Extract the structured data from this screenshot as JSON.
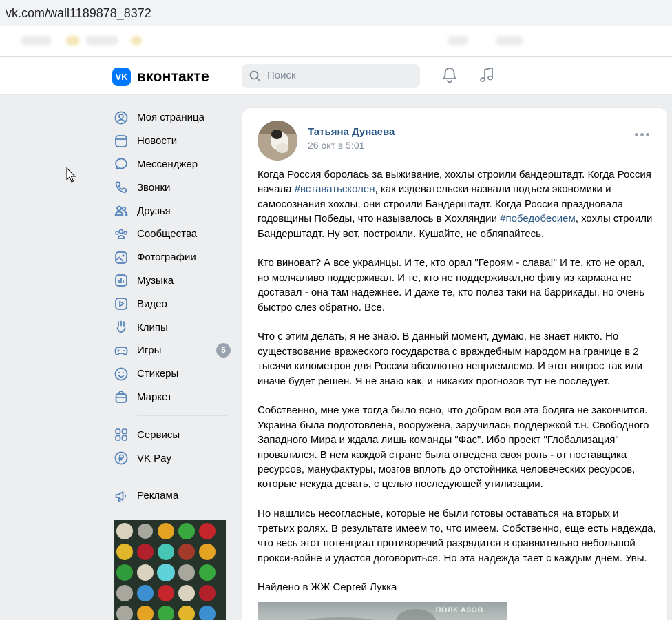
{
  "browser": {
    "url": "vk.com/wall1189878_8372"
  },
  "header": {
    "logo_mark": "VK",
    "logo_text": "вконтакте",
    "search_placeholder": "Поиск",
    "icons": [
      "bell-icon",
      "music-note-icon"
    ]
  },
  "sidebar": {
    "items": [
      {
        "label": "Моя страница",
        "icon": "user-circle-icon"
      },
      {
        "label": "Новости",
        "icon": "news-icon"
      },
      {
        "label": "Мессенджер",
        "icon": "chat-bubble-icon"
      },
      {
        "label": "Звонки",
        "icon": "phone-icon"
      },
      {
        "label": "Друзья",
        "icon": "friends-icon"
      },
      {
        "label": "Сообщества",
        "icon": "communities-icon"
      },
      {
        "label": "Фотографии",
        "icon": "photo-icon"
      },
      {
        "label": "Музыка",
        "icon": "music-bars-icon"
      },
      {
        "label": "Видео",
        "icon": "video-icon"
      },
      {
        "label": "Клипы",
        "icon": "clips-icon"
      },
      {
        "label": "Игры",
        "icon": "gamepad-icon",
        "badge": "5"
      },
      {
        "label": "Стикеры",
        "icon": "smile-icon"
      },
      {
        "label": "Маркет",
        "icon": "bag-icon"
      }
    ],
    "items2": [
      {
        "label": "Сервисы",
        "icon": "services-grid-icon"
      },
      {
        "label": "VK Pay",
        "icon": "ruble-icon"
      }
    ],
    "items3": [
      {
        "label": "Реклама",
        "icon": "megaphone-icon"
      }
    ]
  },
  "post": {
    "author": "Татьяна Дунаева",
    "date": "26 окт в 5:01",
    "paragraphs": {
      "p1_a": "Когда Россия боролась за выживание, хохлы строили бандерштадт. Когда Россия начала ",
      "p1_tag1": "#вставатьсколен",
      "p1_b": ", как издевательски назвали подъем экономики и самосознания хохлы, они строили Бандерштадт. Когда Россия праздновала годовщины Победы, что называлось в Хохляндии ",
      "p1_tag2": "#победобесием",
      "p1_c": ", хохлы строили Бандерштадт. Ну вот, построили. Кушайте, не обляпайтесь.",
      "p2": "Кто виноват? А все украинцы. И те, кто орал \"Героям - слава!\" И те, кто не орал, но молчаливо поддерживал. И те, кто не поддерживал,но фигу из кармана не доставал - она там надежнее. И даже те, кто полез таки на баррикады, но очень быстро слез обратно. Все.",
      "p3": "Что с этим делать, я не знаю. В данный момент, думаю, не знает никто. Но существование вражеского государства с враждебным народом на границе в 2 тысячи километров для России абсолютно неприемлемо. И этот вопрос так или иначе будет решен. Я не знаю как, и никаких прогнозов тут не последует.",
      "p4": "Собственно, мне уже тогда было ясно, что добром вся эта бодяга не закончится. Украина была подготовлена, вооружена, заручилась поддержкой т.н. Свободного Западного Мира и ждала лишь команды \"Фас\". Ибо проект \"Глобализация\" провалился. В нем каждой стране была отведена своя роль - от поставщика ресурсов, мануфактуры, мозгов вплоть до отстойника человеческих ресурсов, которые некуда девать, с целью последующей утилизации.",
      "p5": "Но нашлись несогласные, которые не были готовы оставаться на вторых и третьих ролях. В результате имеем то, что имеем. Собственно, еще есть надежда, что весь этот потенциал противоречий разрядится в сравнительно небольшой прокси-войне и удастся договориться. Но эта надежда тает с каждым днем. Увы.",
      "p6": "Найдено в ЖЖ Сергей Лукка"
    },
    "image_caption": "ПОЛК АЗОВ"
  },
  "colors": {
    "vk_blue": "#0077ff",
    "link": "#2a5885",
    "muted": "#818c99",
    "page_bg": "#edeef0"
  }
}
